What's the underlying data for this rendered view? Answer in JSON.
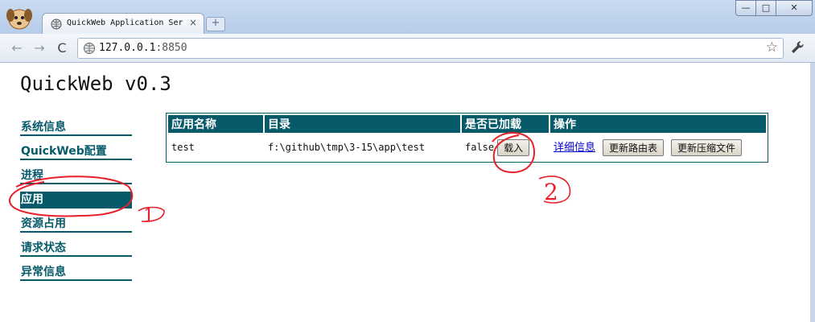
{
  "browser": {
    "tab_title": "QuickWeb Application Ser",
    "tab_close": "×",
    "new_tab": "+",
    "window_controls": {
      "minimize": "—",
      "maximize": "□",
      "close": "✕"
    },
    "nav": {
      "back": "←",
      "forward": "→",
      "reload": "C",
      "star": "☆"
    },
    "url_host": "127.0.0.1",
    "url_port": ":8850"
  },
  "page": {
    "title": "QuickWeb v0.3",
    "sidebar": {
      "items": [
        {
          "label": "系统信息",
          "active": false
        },
        {
          "label": "QuickWeb配置",
          "active": false
        },
        {
          "label": "进程",
          "active": false
        },
        {
          "label": "应用",
          "active": true
        },
        {
          "label": "资源占用",
          "active": false
        },
        {
          "label": "请求状态",
          "active": false
        },
        {
          "label": "异常信息",
          "active": false
        }
      ]
    },
    "table": {
      "headers": [
        "应用名称",
        "目录",
        "是否已加载",
        "操作"
      ],
      "rows": [
        {
          "name": "test",
          "directory": "f:\\github\\tmp\\3-15\\app\\test",
          "loaded": "false",
          "load_button": "载入",
          "detail_link": "详细信息",
          "update_routes_button": "更新路由表",
          "update_compress_button": "更新压缩文件"
        }
      ]
    }
  },
  "annotations": {
    "mark_1": "1",
    "mark_2": "2",
    "color": "#e8202a"
  },
  "colors": {
    "accent": "#065a6a",
    "titlebar": "#c9dbf1",
    "link": "#0000cc"
  }
}
